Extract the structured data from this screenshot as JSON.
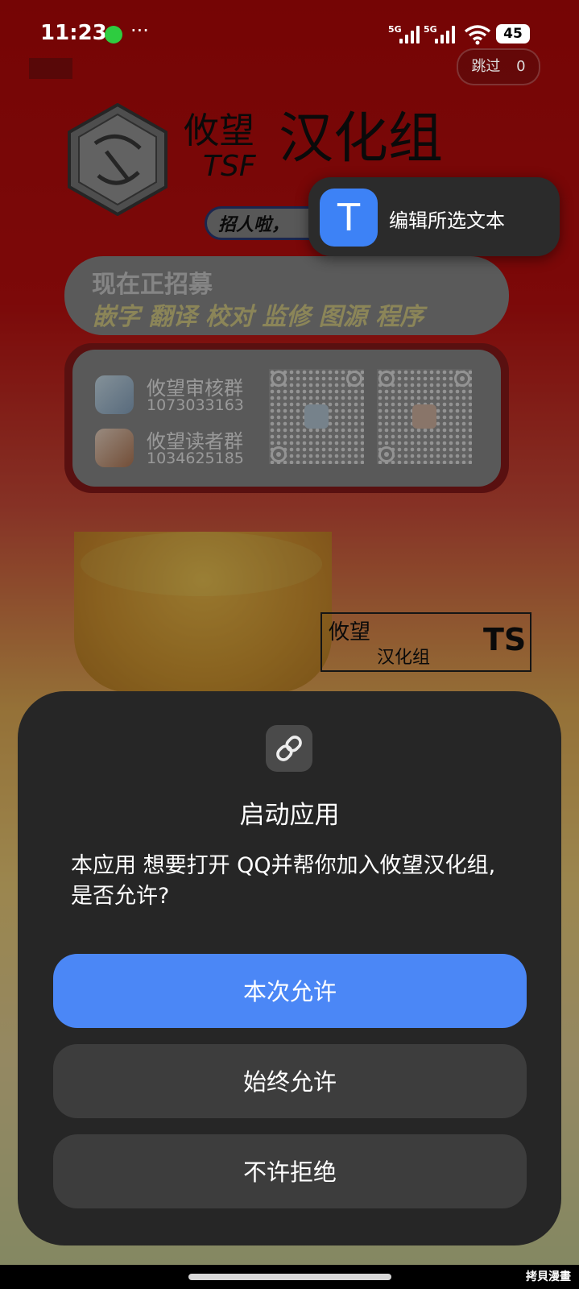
{
  "status_bar": {
    "time": "11:23",
    "more": "···",
    "signal_1": "5G",
    "signal_2": "5G",
    "battery": "45"
  },
  "ad": {
    "skip_label": "跳过",
    "skip_count": "0",
    "logo_small": "攸望",
    "logo_tsf": "TSF",
    "logo_main": "汉化组",
    "pill_text": "招人啦，",
    "recruit_title": "现在正招募",
    "recruit_roles": "嵌字 翻译 校对 监修 图源 程序",
    "groups": [
      {
        "name": "攸望审核群",
        "number": "1073033163"
      },
      {
        "name": "攸望读者群",
        "number": "1034625185"
      }
    ],
    "stamp_line1": "攸望",
    "stamp_line2": "汉化组",
    "stamp_mark": "TS"
  },
  "text_popup": {
    "icon_glyph": "T",
    "label": "编辑所选文本"
  },
  "dialog": {
    "title": "启动应用",
    "message": "本应用 想要打开 QQ并帮你加入攸望汉化组,是否允许?",
    "buttons": {
      "allow_once": "本次允许",
      "allow_always": "始终允许",
      "deny": "不许拒绝"
    }
  },
  "watermark": "拷貝漫畫",
  "colors": {
    "primary_button": "#4b87f6",
    "sheet_bg": "#262626",
    "secondary_button": "#3d3d3d"
  }
}
